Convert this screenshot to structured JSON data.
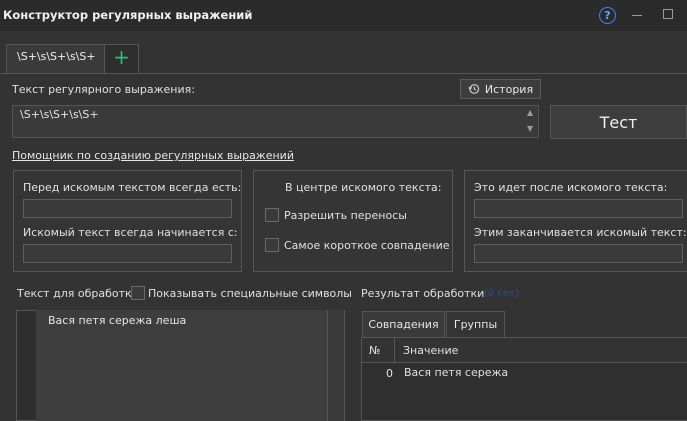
{
  "window": {
    "title": "Конструктор регулярных выражений",
    "help_glyph": "?",
    "accent_color": "#3b82f6"
  },
  "tabs": {
    "regex_tab_label": "\\S+\\s\\S+\\s\\S+",
    "add_glyph": "+"
  },
  "regex": {
    "label": "Текст регулярного выражения:",
    "history_button": "История",
    "value": "\\S+\\s\\S+\\s\\S+",
    "test_button": "Тест"
  },
  "helper": {
    "link": "Помощник по созданию регулярных выражений",
    "before": {
      "label": "Перед искомым текстом всегда есть:",
      "value": "",
      "starts_label": "Искомый текст всегда начинается с:",
      "starts_value": ""
    },
    "center": {
      "label": "В центре искомого текста:",
      "allow_breaks": "Разрешить переносы",
      "shortest_match": "Самое короткое совпадение"
    },
    "after": {
      "label": "Это идет после искомого текста:",
      "value": "",
      "ends_label": "Этим заканчивается искомый текст:",
      "ends_value": ""
    }
  },
  "input": {
    "label": "Текст для обработки",
    "show_special": "Показывать специальные символы",
    "text": "Вася петя сережа леша"
  },
  "result": {
    "label": "Результат обработки",
    "time": "(0 сек)",
    "tabs": [
      "Совпадения",
      "Группы"
    ],
    "columns": [
      "№",
      "Значение"
    ],
    "rows": [
      {
        "index": "0",
        "value": "Вася петя сережа"
      }
    ]
  }
}
